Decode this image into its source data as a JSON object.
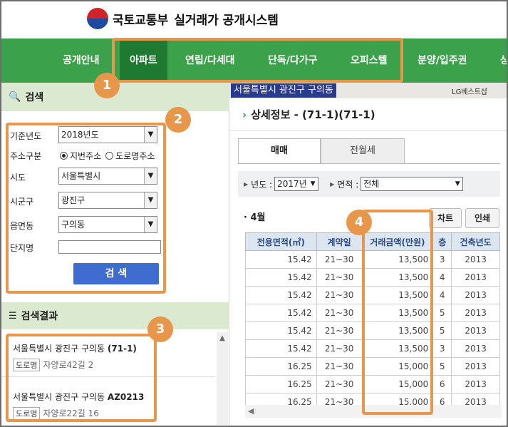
{
  "header": {
    "org_name": "국토교통부",
    "system_name": "실거래가 공개시스템"
  },
  "nav": {
    "items": [
      "공개안내",
      "아파트",
      "연립/다세대",
      "단독/다가구",
      "오피스텔",
      "분양/입주권",
      "상"
    ],
    "active": "아파트"
  },
  "badges": [
    "1",
    "2",
    "3",
    "4"
  ],
  "search": {
    "title": "검색",
    "fields": {
      "year_label": "기준년도",
      "year_value": "2018년도",
      "addr_type_label": "주소구분",
      "addr_type_opt1": "지번주소",
      "addr_type_opt2": "도로명주소",
      "sido_label": "시도",
      "sido_value": "서울특별시",
      "sigungu_label": "시군구",
      "sigungu_value": "광진구",
      "eup_label": "읍면동",
      "eup_value": "구의동",
      "complex_label": "단지명",
      "complex_value": ""
    },
    "button_label": "검 색"
  },
  "results": {
    "title": "검색결과",
    "items": [
      {
        "addr": "서울특별시 광진구 구의동",
        "name": "(71-1)",
        "tag": "도로명",
        "road": "자양로42길 2"
      },
      {
        "addr": "서울특별시 광진구 구의동",
        "name": "AZ0213",
        "tag": "도로명",
        "road": "자양로22길 16"
      }
    ]
  },
  "map": {
    "label": "서울특별시 광진구 구의동",
    "sign": "LG베스트샵"
  },
  "detail": {
    "title": "상세정보 - (71-1)(71-1)",
    "tabs": [
      "매매",
      "전월세"
    ],
    "year_label": "년도 :",
    "year_value": "2017년",
    "area_label": "면적 :",
    "area_value": "전체",
    "month": "4월",
    "chart_btn": "차트",
    "print_btn": "인쇄",
    "columns": [
      "전용면적(㎡)",
      "계약일",
      "거래금액(만원)",
      "층",
      "건축년도"
    ],
    "rows": [
      [
        "15.42",
        "21~30",
        "13,500",
        "3",
        "2013"
      ],
      [
        "15.42",
        "21~30",
        "13,500",
        "4",
        "2013"
      ],
      [
        "15.42",
        "21~30",
        "13,500",
        "4",
        "2013"
      ],
      [
        "15.42",
        "21~30",
        "13,500",
        "5",
        "2013"
      ],
      [
        "15.42",
        "21~30",
        "13,500",
        "5",
        "2013"
      ],
      [
        "15.42",
        "21~30",
        "13,500",
        "3",
        "2013"
      ],
      [
        "16.25",
        "21~30",
        "15,000",
        "5",
        "2013"
      ],
      [
        "16.25",
        "21~30",
        "15,000",
        "6",
        "2013"
      ],
      [
        "16.25",
        "21~30",
        "15,000",
        "6",
        "2013"
      ]
    ]
  }
}
